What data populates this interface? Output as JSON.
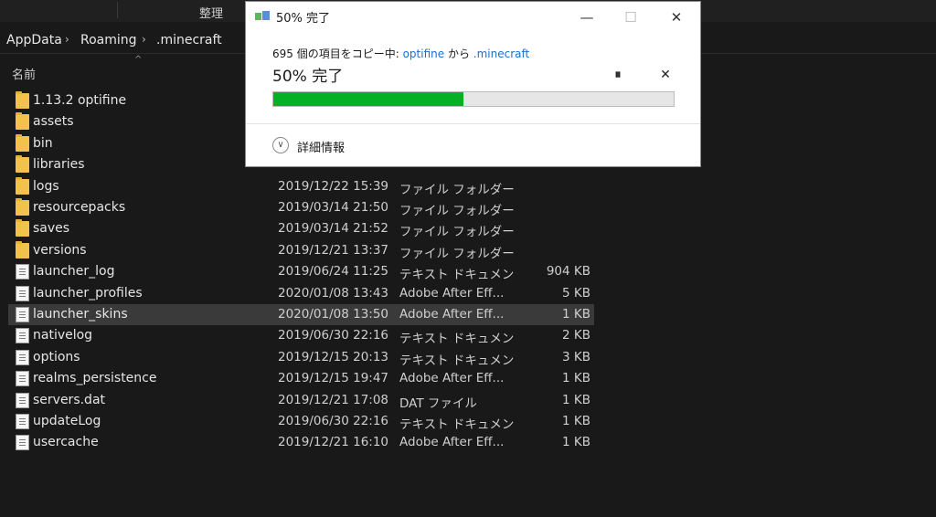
{
  "ribbon": {
    "organize_label": "整理"
  },
  "address": {
    "crumbs": [
      "AppData",
      "Roaming",
      ".minecraft"
    ],
    "separator": "›"
  },
  "list_header": {
    "name_label": "名前"
  },
  "files": [
    {
      "name": "1.13.2 optifine",
      "date": "",
      "type": "",
      "size": "",
      "kind": "folder"
    },
    {
      "name": "assets",
      "date": "",
      "type": "",
      "size": "",
      "kind": "folder"
    },
    {
      "name": "bin",
      "date": "",
      "type": "",
      "size": "",
      "kind": "folder"
    },
    {
      "name": "libraries",
      "date": "",
      "type": "",
      "size": "",
      "kind": "folder"
    },
    {
      "name": "logs",
      "date": "2019/12/22 15:39",
      "type": "ファイル フォルダー",
      "size": "",
      "kind": "folder"
    },
    {
      "name": "resourcepacks",
      "date": "2019/03/14 21:50",
      "type": "ファイル フォルダー",
      "size": "",
      "kind": "folder"
    },
    {
      "name": "saves",
      "date": "2019/03/14 21:52",
      "type": "ファイル フォルダー",
      "size": "",
      "kind": "folder"
    },
    {
      "name": "versions",
      "date": "2019/12/21 13:37",
      "type": "ファイル フォルダー",
      "size": "",
      "kind": "folder"
    },
    {
      "name": "launcher_log",
      "date": "2019/06/24 11:25",
      "type": "テキスト ドキュメント",
      "size": "904 KB",
      "kind": "doc"
    },
    {
      "name": "launcher_profiles",
      "date": "2020/01/08 13:43",
      "type": "Adobe After Eff...",
      "size": "5 KB",
      "kind": "doc"
    },
    {
      "name": "launcher_skins",
      "date": "2020/01/08 13:50",
      "type": "Adobe After Eff...",
      "size": "1 KB",
      "kind": "doc",
      "selected": true
    },
    {
      "name": "nativelog",
      "date": "2019/06/30 22:16",
      "type": "テキスト ドキュメント",
      "size": "2 KB",
      "kind": "doc"
    },
    {
      "name": "options",
      "date": "2019/12/15 20:13",
      "type": "テキスト ドキュメント",
      "size": "3 KB",
      "kind": "doc"
    },
    {
      "name": "realms_persistence",
      "date": "2019/12/15 19:47",
      "type": "Adobe After Eff...",
      "size": "1 KB",
      "kind": "doc"
    },
    {
      "name": "servers.dat",
      "date": "2019/12/21 17:08",
      "type": "DAT ファイル",
      "size": "1 KB",
      "kind": "doc"
    },
    {
      "name": "updateLog",
      "date": "2019/06/30 22:16",
      "type": "テキスト ドキュメント",
      "size": "1 KB",
      "kind": "doc"
    },
    {
      "name": "usercache",
      "date": "2019/12/21 16:10",
      "type": "Adobe After Eff...",
      "size": "1 KB",
      "kind": "doc"
    }
  ],
  "dialog": {
    "title": "50% 完了",
    "copy_prefix": "695 個の項目をコピー中: ",
    "source": "optifine",
    "from_word": " から ",
    "destination": ".minecraft",
    "percent_text": "50% 完了",
    "progress": 0.475,
    "pause_glyph": "⏸",
    "cancel_glyph": "✕",
    "more_details_label": "詳細情報",
    "minimize_glyph": "—",
    "maximize_glyph": "☐",
    "close_glyph": "✕"
  },
  "colors": {
    "progress_fill": "#06b025",
    "link": "#1a6fcf",
    "folder": "#f2c14e"
  }
}
